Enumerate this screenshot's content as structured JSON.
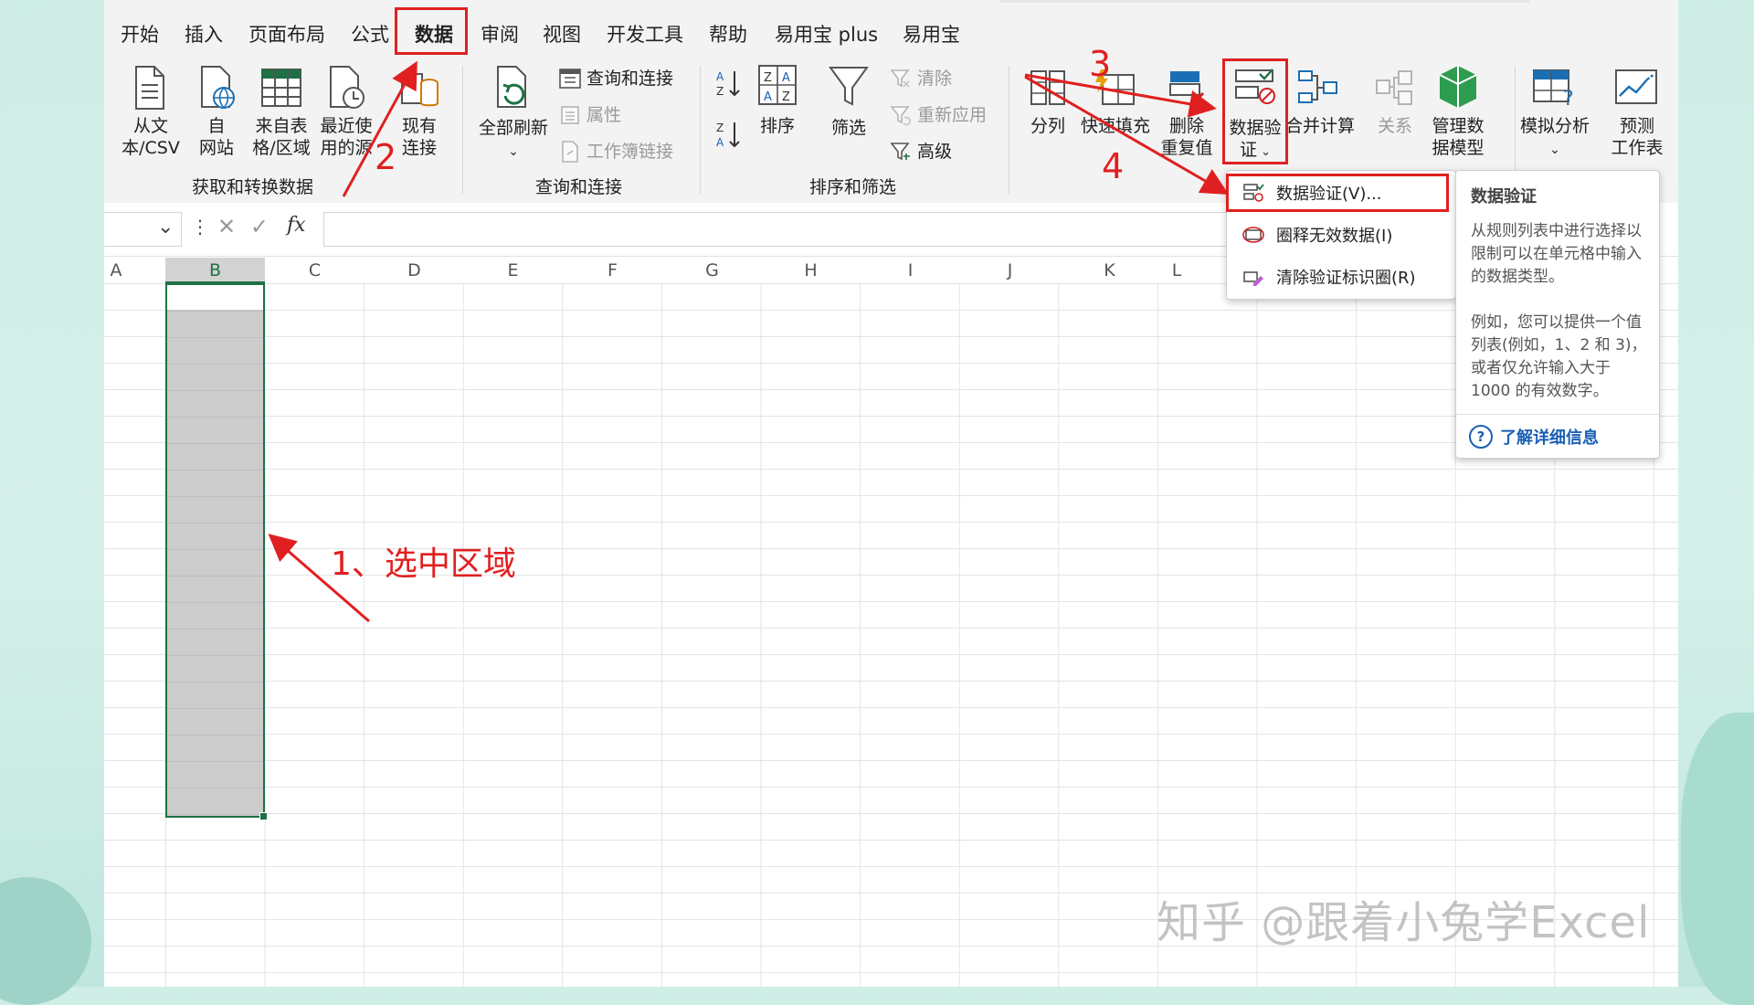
{
  "tabs": [
    "开始",
    "插入",
    "页面布局",
    "公式",
    "数据",
    "审阅",
    "视图",
    "开发工具",
    "帮助",
    "易用宝 plus",
    "易用宝"
  ],
  "active_tab": "数据",
  "ribbon": {
    "get_transform": {
      "group_label": "获取和转换数据",
      "buttons": [
        {
          "l1": "从文",
          "l2": "本/CSV"
        },
        {
          "l1": "自",
          "l2": "网站"
        },
        {
          "l1": "来自表",
          "l2": "格/区域"
        },
        {
          "l1": "最近使",
          "l2": "用的源"
        },
        {
          "l1": "现有",
          "l2": "连接"
        }
      ]
    },
    "queries": {
      "group_label": "查询和连接",
      "refresh_all": "全部刷新",
      "items": [
        "查询和连接",
        "属性",
        "工作簿链接"
      ]
    },
    "sort_filter": {
      "group_label": "排序和筛选",
      "sort": "排序",
      "filter": "筛选",
      "items": [
        "清除",
        "重新应用",
        "高级"
      ]
    },
    "data_tools": {
      "split": "分列",
      "flash_fill": "快速填充",
      "remove_dup_l1": "删除",
      "remove_dup_l2": "重复值",
      "validation_l1": "数据验",
      "validation_l2": "证",
      "consolidate": "合并计算",
      "relationships": "关系",
      "data_model_l1": "管理数",
      "data_model_l2": "据模型"
    },
    "forecast": {
      "whatif": "模拟分析",
      "forecast_l1": "预测",
      "forecast_l2": "工作表"
    }
  },
  "formula_bar": {
    "fx": "fx",
    "value": ""
  },
  "columns": [
    "A",
    "B",
    "C",
    "D",
    "E",
    "F",
    "G",
    "H",
    "I",
    "J",
    "K",
    "L"
  ],
  "dropdown": {
    "items": [
      "数据验证(V)...",
      "圈释无效数据(I)",
      "清除验证标识圈(R)"
    ]
  },
  "tooltip": {
    "title": "数据验证",
    "p1": "从规则列表中进行选择以限制可以在单元格中输入的数据类型。",
    "p2": "例如，您可以提供一个值列表(例如，1、2 和 3)，或者仅允许输入大于 1000 的有效数字。",
    "link": "了解详细信息"
  },
  "annotations": {
    "n2": "2",
    "n3": "3",
    "n4": "4",
    "note1": "1、选中区域"
  },
  "watermark": "知乎 @跟着小兔学Excel",
  "colors": {
    "annotation": "#e02020",
    "selection_border": "#1e7145",
    "link": "#1a5fb4"
  }
}
